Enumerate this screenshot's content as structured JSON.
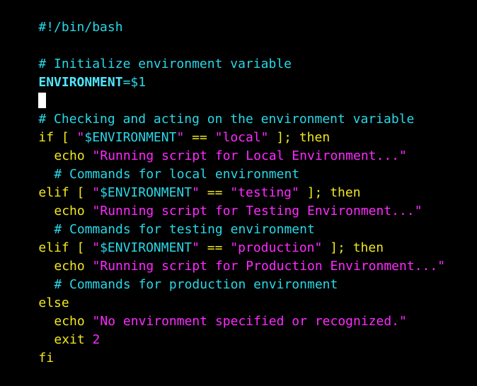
{
  "editor": {
    "lines": [
      {
        "shebang": "#!/bin/bash"
      },
      {},
      {
        "comment": "# Initialize environment variable"
      },
      {
        "var": "ENVIRONMENT",
        "assign": "=$1"
      },
      {},
      {
        "comment": "# Checking and acting on the environment variable"
      },
      {
        "kw1": "if [ ",
        "q1": "\"",
        "v1": "$ENVIRONMENT",
        "q2": "\"",
        "op": " == ",
        "s1": "\"local\"",
        "kw2": " ]; then"
      },
      {
        "kw": "echo ",
        "str": "\"Running script for Local Environment...\""
      },
      {
        "comment": "# Commands for local environment"
      },
      {
        "kw1": "elif [ ",
        "q1": "\"",
        "v1": "$ENVIRONMENT",
        "q2": "\"",
        "op": " == ",
        "s1": "\"testing\"",
        "kw2": " ]; then"
      },
      {
        "kw": "echo ",
        "str": "\"Running script for Testing Environment...\""
      },
      {
        "comment": "# Commands for testing environment"
      },
      {
        "kw1": "elif [ ",
        "q1": "\"",
        "v1": "$ENVIRONMENT",
        "q2": "\"",
        "op": " == ",
        "s1": "\"production\"",
        "kw2": " ]; then"
      },
      {
        "kw": "echo ",
        "str": "\"Running script for Production Environment...\""
      },
      {
        "comment": "# Commands for production environment"
      },
      {
        "kw": "else"
      },
      {
        "kw": "echo ",
        "str": "\"No environment specified or recognized.\""
      },
      {
        "kw": "exit ",
        "num": "2"
      },
      {
        "kw": "fi"
      }
    ]
  },
  "colors": {
    "background": "#000000",
    "comment": "#28d8e8",
    "keyword": "#f0e820",
    "string": "#ff2aff",
    "variable": "#4ee8ff",
    "cursor": "#ffffff"
  }
}
